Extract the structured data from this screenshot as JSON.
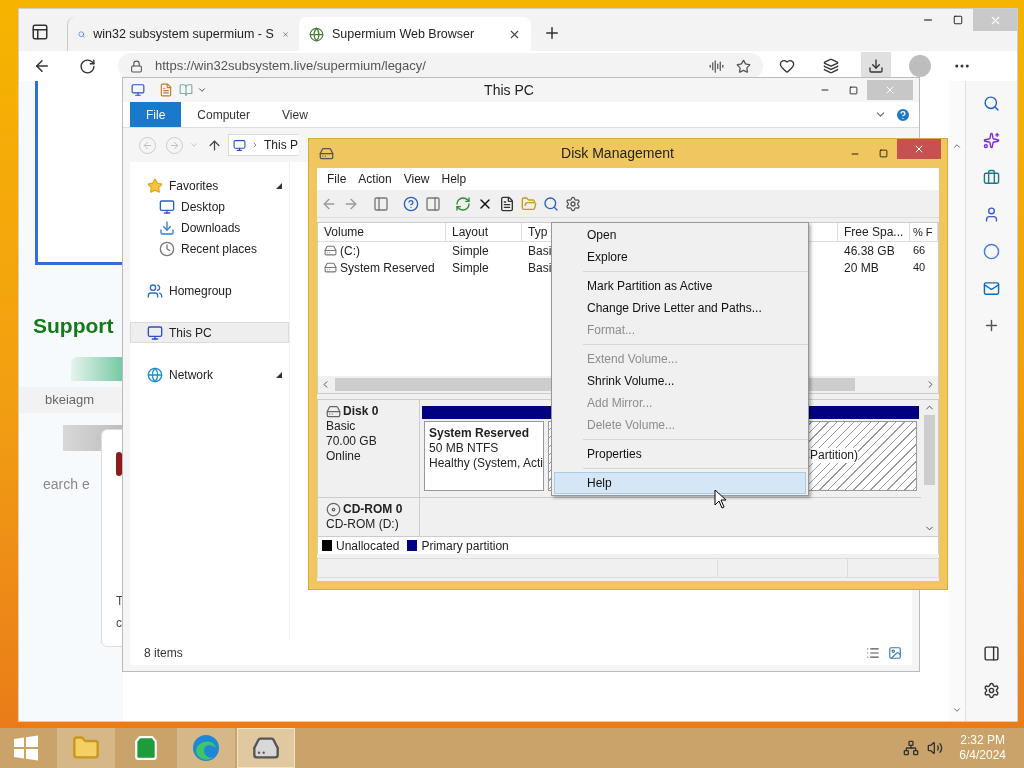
{
  "browser": {
    "tabs": [
      {
        "label": "win32 subsystem supermium - S",
        "selected": false
      },
      {
        "label": "Supermium Web Browser",
        "selected": true
      }
    ],
    "url": "https://win32subsystem.live/supermium/legacy/",
    "page": {
      "heading": "Support",
      "row_text": "bkeiagm",
      "search_text": "earch e",
      "card_texts": [
        "T",
        "c"
      ]
    }
  },
  "explorer": {
    "title": "This PC",
    "ribbon_tabs": [
      {
        "label": "File",
        "selected": true
      },
      {
        "label": "Computer",
        "selected": false
      },
      {
        "label": "View",
        "selected": false
      }
    ],
    "address": "This P",
    "nav": [
      {
        "label": "Favorites",
        "kind": "favorites",
        "selected": false,
        "expanded": true,
        "children": [
          {
            "label": "Desktop",
            "kind": "desktop",
            "selected": false
          },
          {
            "label": "Downloads",
            "kind": "downloads",
            "selected": false
          },
          {
            "label": "Recent places",
            "kind": "recent",
            "selected": false
          }
        ]
      },
      {
        "label": "Homegroup",
        "kind": "homegroup",
        "selected": false,
        "expanded": false
      },
      {
        "label": "This PC",
        "kind": "pc",
        "selected": true,
        "expanded": false
      },
      {
        "label": "Network",
        "kind": "network",
        "selected": false,
        "expanded": true
      }
    ],
    "status": "8 items"
  },
  "disk_management": {
    "title": "Disk Management",
    "menu": [
      "File",
      "Action",
      "View",
      "Help"
    ],
    "columns": [
      "Volume",
      "Layout",
      "Typ",
      "Free Spa...",
      "% F"
    ],
    "rows": [
      {
        "cells": [
          "(C:)",
          "Simple",
          "Basi",
          "46.38 GB",
          "66"
        ]
      },
      {
        "cells": [
          "System Reserved",
          "Simple",
          "Basi",
          "20 MB",
          "40"
        ]
      }
    ],
    "disks": [
      {
        "name": "Disk 0",
        "kind": "disk",
        "lines": [
          "Basic",
          "70.00 GB",
          "Online"
        ],
        "partitions": [
          {
            "title": "System Reserved",
            "lines": [
              "50 MB NTFS",
              "Healthy (System, Acti"
            ],
            "selected": false
          },
          {
            "lines": [
              "Partition)"
            ],
            "selected": true
          }
        ]
      },
      {
        "name": "CD-ROM 0",
        "kind": "cdrom",
        "lines": [
          "CD-ROM (D:)"
        ]
      }
    ],
    "legend": [
      {
        "label": "Unallocated",
        "color": "#000000"
      },
      {
        "label": "Primary partition",
        "color": "#000080"
      }
    ]
  },
  "context_menu": [
    {
      "kind": "item",
      "label": "Open",
      "disabled": false,
      "selected": false
    },
    {
      "kind": "item",
      "label": "Explore",
      "disabled": false,
      "selected": false
    },
    {
      "kind": "separator"
    },
    {
      "kind": "item",
      "label": "Mark Partition as Active",
      "disabled": false,
      "selected": false
    },
    {
      "kind": "item",
      "label": "Change Drive Letter and Paths...",
      "disabled": false,
      "selected": false
    },
    {
      "kind": "item",
      "label": "Format...",
      "disabled": true,
      "selected": false
    },
    {
      "kind": "separator"
    },
    {
      "kind": "item",
      "label": "Extend Volume...",
      "disabled": true,
      "selected": false
    },
    {
      "kind": "item",
      "label": "Shrink Volume...",
      "disabled": false,
      "selected": false
    },
    {
      "kind": "item",
      "label": "Add Mirror...",
      "disabled": true,
      "selected": false
    },
    {
      "kind": "item",
      "label": "Delete Volume...",
      "disabled": true,
      "selected": false
    },
    {
      "kind": "separator"
    },
    {
      "kind": "item",
      "label": "Properties",
      "disabled": false,
      "selected": false
    },
    {
      "kind": "separator"
    },
    {
      "kind": "item",
      "label": "Help",
      "disabled": false,
      "selected": true
    }
  ],
  "taskbar": {
    "apps": [
      {
        "kind": "explorer",
        "running": true,
        "selected": false
      },
      {
        "kind": "store",
        "running": false,
        "selected": false
      },
      {
        "kind": "edge",
        "running": true,
        "selected": false
      },
      {
        "kind": "diskmgmt",
        "running": true,
        "selected": true
      }
    ],
    "time": "2:32 PM",
    "date": "6/4/2024"
  }
}
